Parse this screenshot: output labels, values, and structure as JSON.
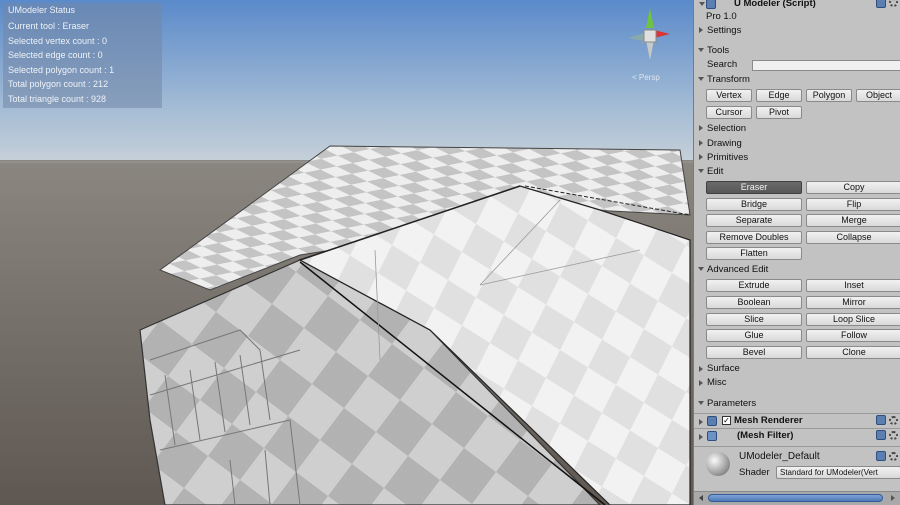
{
  "status": {
    "title": "UModeler Status",
    "current_tool": "Current tool : Eraser",
    "selected_vertex": "Selected vertex count : 0",
    "selected_edge": "Selected edge count : 0",
    "selected_polygon": "Selected polygon count : 1",
    "total_polygon": "Total polygon count : 212",
    "total_triangle": "Total triangle count : 928"
  },
  "scene": {
    "gizmo_label": "< Persp"
  },
  "inspector": {
    "component_title": "U Modeler (Script)",
    "version": "Pro 1.0",
    "settings": "Settings",
    "tools": "Tools",
    "search_label": "Search",
    "search_value": "",
    "transform": "Transform",
    "transform_buttons": [
      "Vertex",
      "Edge",
      "Polygon",
      "Object",
      "Cursor",
      "Pivot"
    ],
    "selection": "Selection",
    "drawing": "Drawing",
    "primitives": "Primitives",
    "edit": "Edit",
    "edit_buttons": [
      "Eraser",
      "Copy",
      "Bridge",
      "Flip",
      "Separate",
      "Merge",
      "Remove Doubles",
      "Collapse",
      "Flatten"
    ],
    "advanced_edit": "Advanced Edit",
    "advanced_buttons": [
      "Extrude",
      "Inset",
      "Boolean",
      "Mirror",
      "Slice",
      "Loop Slice",
      "Glue",
      "Follow",
      "Bevel",
      "Clone"
    ],
    "surface": "Surface",
    "misc": "Misc",
    "parameters": "Parameters",
    "mesh_renderer": "Mesh Renderer",
    "mesh_filter": "(Mesh Filter)",
    "material_name": "UModeler_Default",
    "shader_label": "Shader",
    "shader_value": "Standard for UModeler(Vert"
  },
  "colors": {
    "active_button": "#5f5f5f",
    "panel": "#c2c2c2",
    "sky_top": "#5d8ccb",
    "ground": "#6e6660"
  }
}
